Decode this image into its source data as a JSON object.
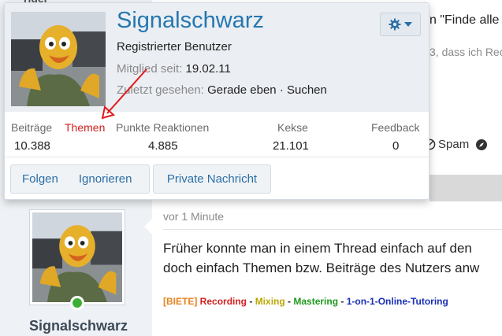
{
  "background": {
    "top_fragment": "rider",
    "quote_fragment": "n \"Finde alle",
    "sub_fragment": "3, dass ich Rec",
    "actions": {
      "spam_label": "Spam",
      "spam_icon": "flag-icon",
      "other_icon": "compass-icon"
    },
    "post": {
      "time": "vor 1 Minute",
      "line1": "Früher konnte man in einem Thread einfach auf den",
      "line2": "doch einfach Themen bzw. Beiträge des Nutzers anw",
      "signature": [
        {
          "text": "[BIETE]",
          "color": "#e8821e"
        },
        {
          "text": " Recording",
          "color": "#d21f1f"
        },
        {
          "text": " - ",
          "color": "#222222"
        },
        {
          "text": "Mixing",
          "color": "#b8a800"
        },
        {
          "text": " - ",
          "color": "#222222"
        },
        {
          "text": "Mastering",
          "color": "#1e9a1e"
        },
        {
          "text": " - ",
          "color": "#222222"
        },
        {
          "text": "1-on-1-Online-Tutoring",
          "color": "#1a2fb5"
        }
      ]
    },
    "author": {
      "username": "Signalschwarz"
    }
  },
  "card": {
    "username": "Signalschwarz",
    "user_title": "Registrierter Benutzer",
    "member_since_label": "Mitglied seit:",
    "member_since_value": "19.02.11",
    "last_seen_label": "Zuletzt gesehen:",
    "last_seen_value": "Gerade eben · Suchen",
    "gear_icon": "gear-icon",
    "stats": [
      {
        "label": "Beiträge",
        "value": "10.388"
      },
      {
        "label": "Themen",
        "value": ""
      },
      {
        "label": "Punkte Reaktionen",
        "value": "4.885"
      },
      {
        "label": "Kekse",
        "value": "21.101"
      },
      {
        "label": "Feedback",
        "value": "0"
      }
    ],
    "buttons": {
      "follow": "Folgen",
      "ignore": "Ignorieren",
      "private_message": "Private Nachricht"
    }
  },
  "annotation": {
    "color": "#e01b1b"
  },
  "colors": {
    "accent": "#2577b1",
    "online": "#3cb034"
  }
}
